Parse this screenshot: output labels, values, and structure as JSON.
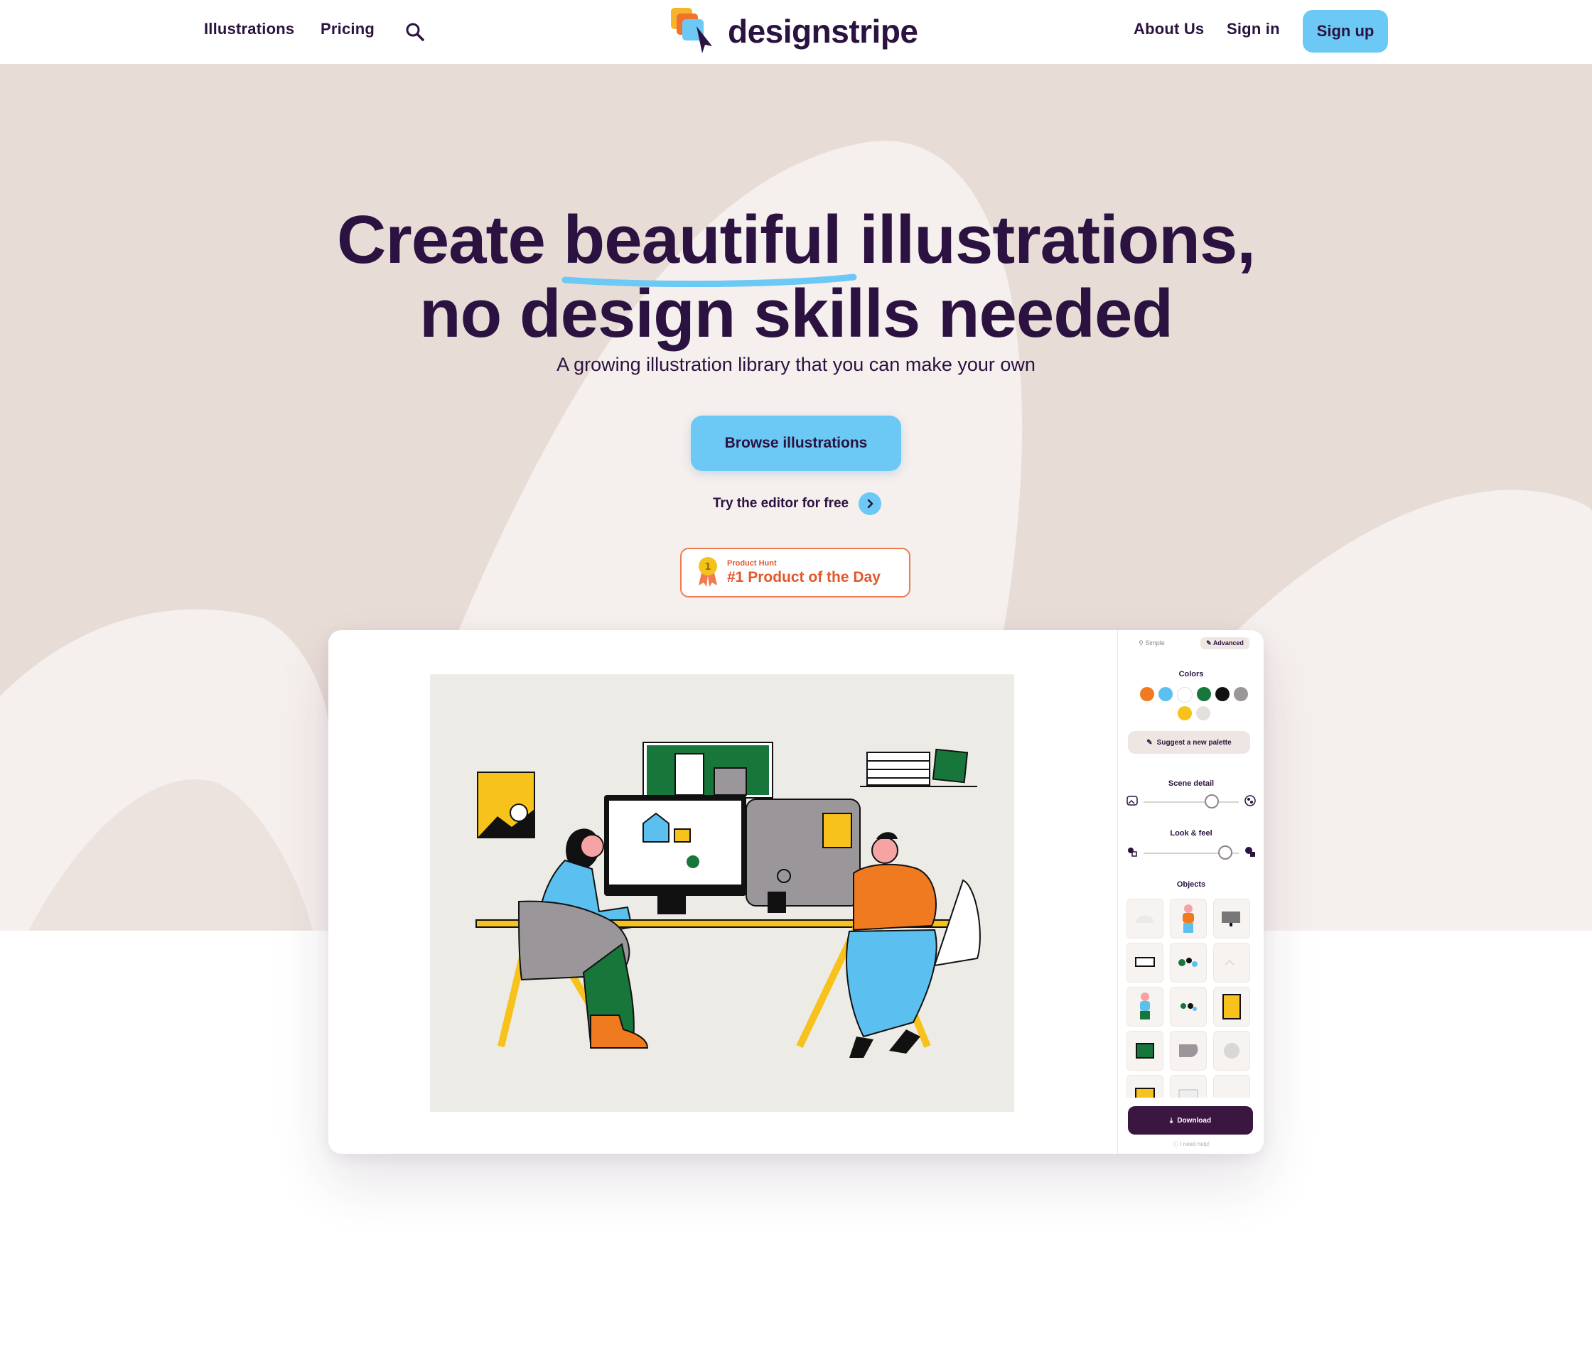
{
  "header": {
    "nav_left": [
      "Illustrations",
      "Pricing"
    ],
    "logo_text": "designstripe",
    "nav_right": [
      "About Us",
      "Sign in"
    ],
    "signup_label": "Sign up"
  },
  "hero": {
    "title_before": "Create ",
    "title_highlight": "beautiful",
    "title_after": " illustrations,",
    "title_line2": "no design skills needed",
    "subtitle": "A growing illustration library that you can make your own",
    "browse_label": "Browse illustrations",
    "try_editor_label": "Try the editor for free",
    "badge_small": "Product Hunt",
    "badge_big": "#1 Product of the Day",
    "badge_medal_number": "1"
  },
  "editor": {
    "tabs": [
      "Simple",
      "Advanced"
    ],
    "active_tab": "Advanced",
    "colors_label": "Colors",
    "palette": [
      "#f07a1f",
      "#5bc0ef",
      "#ffffff",
      "#17763a",
      "#111111",
      "#9a9699",
      "#f6c21b",
      "#e4e0dc"
    ],
    "suggest_label": "Suggest a new palette",
    "scene_detail_label": "Scene detail",
    "scene_detail_value": 0.72,
    "look_feel_label": "Look & feel",
    "look_feel_value": 0.86,
    "objects_label": "Objects",
    "download_label": "Download",
    "help_label": "I need help!"
  },
  "colors": {
    "brand_dark": "#2b1240",
    "accent_blue": "#6cc8f4",
    "hero_bg": "#e8dcd7",
    "badge_orange": "#e2572b"
  }
}
